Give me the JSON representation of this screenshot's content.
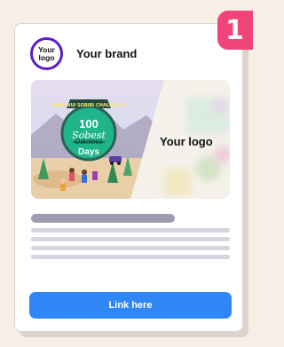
{
  "step": {
    "number": "1"
  },
  "header": {
    "logo_line1": "Your",
    "logo_line2": "logo",
    "brand": "Your brand"
  },
  "banner": {
    "challenge_text": "RAPA NUI SOBIBI CHALLENGE",
    "days_number": "100",
    "script_word": "Sobest",
    "struck_word": "Dateless",
    "days_label": "Days",
    "logo_placeholder": "Your logo"
  },
  "body_text": {
    "placeholder_lines": 5
  },
  "cta": {
    "label": "Link here"
  },
  "colors": {
    "accent": "#2f86f5",
    "badge": "#f0457a",
    "logo_ring": "#5a1ec8"
  }
}
